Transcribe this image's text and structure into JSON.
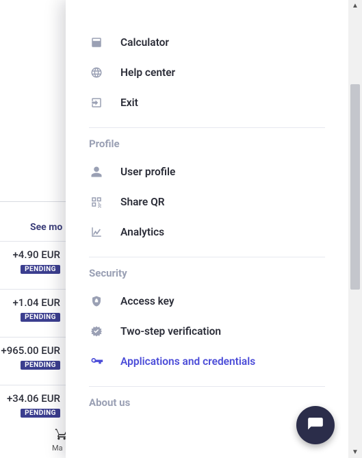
{
  "colors": {
    "accent": "#4b4cd8",
    "muted": "#9aa0b4",
    "text": "#2b2d38",
    "badge": "#3b3e8f"
  },
  "background": {
    "see_more": "See mo",
    "rows": [
      {
        "amount": "+4.90 EUR",
        "status": "PENDING"
      },
      {
        "amount": "+1.04 EUR",
        "status": "PENDING"
      },
      {
        "amount": "+965.00 EUR",
        "status": "PENDING"
      },
      {
        "amount": "+34.06 EUR",
        "status": "PENDING"
      }
    ],
    "bottom_label": "Ma"
  },
  "menu": {
    "top": [
      {
        "icon": "calculator-icon",
        "label": "Calculator"
      },
      {
        "icon": "globe-icon",
        "label": "Help center"
      },
      {
        "icon": "exit-icon",
        "label": "Exit"
      }
    ],
    "sections": [
      {
        "title": "Profile",
        "items": [
          {
            "icon": "user-icon",
            "label": "User profile"
          },
          {
            "icon": "qr-icon",
            "label": "Share QR"
          },
          {
            "icon": "analytics-icon",
            "label": "Analytics"
          }
        ]
      },
      {
        "title": "Security",
        "items": [
          {
            "icon": "shield-icon",
            "label": "Access key"
          },
          {
            "icon": "verified-icon",
            "label": "Two-step verification"
          },
          {
            "icon": "key-icon",
            "label": "Applications and credentials",
            "active": true
          }
        ]
      },
      {
        "title": "About us",
        "items": []
      }
    ]
  }
}
